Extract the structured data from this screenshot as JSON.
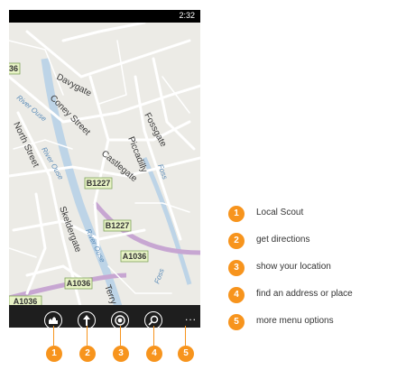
{
  "status_bar": {
    "time": "2:32"
  },
  "map": {
    "street_labels": [
      "Davygate",
      "Coney Street",
      "North Street",
      "Piccadilly",
      "Fossgate",
      "Castlegate",
      "Skeldergate",
      "Terry Av"
    ],
    "river_labels": [
      "River Ouse",
      "River Ouse",
      "River Ouse",
      "Foss",
      "Foss"
    ],
    "road_shields": [
      "B1227",
      "B1227",
      "A1036",
      "A1036",
      "A1036",
      "36"
    ],
    "colors": {
      "background": "#ecebe6",
      "road": "#ffffff",
      "river": "#bdd4e7",
      "major_road": "#c7a6d2"
    }
  },
  "app_bar": {
    "icons": [
      "local-scout-icon",
      "directions-icon",
      "location-icon",
      "search-icon"
    ],
    "more_label": "..."
  },
  "markers": [
    "1",
    "2",
    "3",
    "4",
    "5"
  ],
  "legend": [
    {
      "num": "1",
      "label": "Local Scout"
    },
    {
      "num": "2",
      "label": "get directions"
    },
    {
      "num": "3",
      "label": "show your location"
    },
    {
      "num": "4",
      "label": "find an address or place"
    },
    {
      "num": "5",
      "label": "more menu options"
    }
  ],
  "accent_color": "#f7941d"
}
